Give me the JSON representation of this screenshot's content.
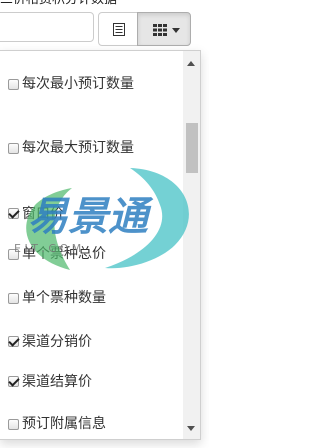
{
  "top_text": "三价格费积分计数据",
  "toolbar": {
    "list_view_icon": "list-view-icon",
    "columns_icon": "columns-grid-icon",
    "caret_icon": "caret-down-icon"
  },
  "dropdown": {
    "items": [
      {
        "label": "每次最小预订数量",
        "checked": false
      },
      {
        "label": "每次最大预订数量",
        "checked": false
      },
      {
        "label": "窗口价",
        "checked": true
      },
      {
        "label": "单个票种总价",
        "checked": false
      },
      {
        "label": "单个票种数量",
        "checked": false
      },
      {
        "label": "渠道分销价",
        "checked": true
      },
      {
        "label": "渠道结算价",
        "checked": true
      },
      {
        "label": "预订附属信息",
        "checked": false
      }
    ]
  },
  "watermark": {
    "brand": "易景通",
    "sub": "E  J  T  .  C  O  M"
  },
  "colors": {
    "watermark_blue": "#2e7fc1",
    "watermark_green": "#4bb86a",
    "watermark_teal": "#46c2c6"
  }
}
